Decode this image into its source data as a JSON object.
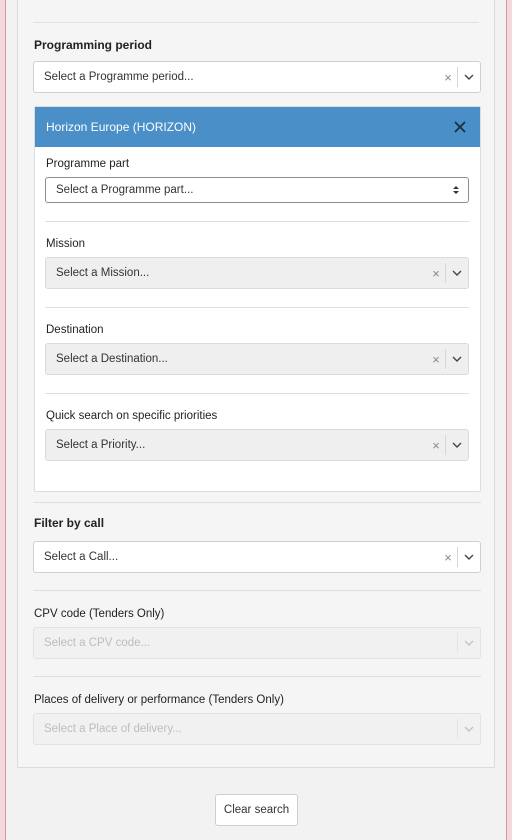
{
  "filters": {
    "programming_period": {
      "title": "Programming period",
      "placeholder": "Select a Programme period..."
    },
    "horizon": {
      "title": "Horizon Europe (HORIZON)",
      "programme_part": {
        "label": "Programme part",
        "placeholder": "Select a Programme part..."
      },
      "mission": {
        "label": "Mission",
        "placeholder": "Select a Mission..."
      },
      "destination": {
        "label": "Destination",
        "placeholder": "Select a Destination..."
      },
      "priority": {
        "label": "Quick search on specific priorities",
        "placeholder": "Select a Priority..."
      }
    },
    "call": {
      "title": "Filter by call",
      "placeholder": "Select a Call..."
    },
    "cpv": {
      "label": "CPV code (Tenders Only)",
      "placeholder": "Select a CPV code..."
    },
    "delivery": {
      "label": "Places of delivery or performance (Tenders Only)",
      "placeholder": "Select a Place of delivery..."
    },
    "clear_symbol": "×"
  },
  "actions": {
    "clear_search": "Clear search"
  },
  "colors": {
    "horizon_header": "#4a8fc7",
    "page_border": "#d89aa2"
  },
  "icons": {
    "dropdown": "chevron-down-icon",
    "close": "close-icon",
    "native_select": "sort-arrows-icon"
  }
}
